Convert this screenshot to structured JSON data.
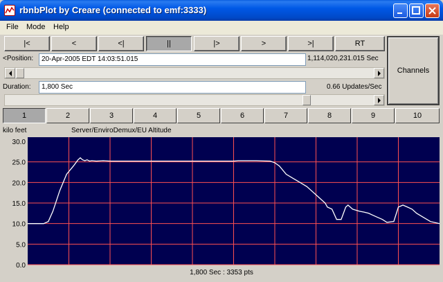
{
  "window": {
    "title": "rbnbPlot by Creare (connected to emf:3333)"
  },
  "menu": [
    "File",
    "Mode",
    "Help"
  ],
  "nav_buttons": [
    "|<",
    "<",
    "<|",
    "||",
    "|>",
    ">",
    ">|",
    "RT"
  ],
  "position": {
    "label": "<Position:",
    "value": "20-Apr-2005 EDT 14:03:51.015",
    "seconds": "1,114,020,231.015 Sec"
  },
  "duration": {
    "label": "Duration:",
    "value": "1,800 Sec",
    "rate": "0.66 Updates/Sec"
  },
  "channels_label": "Channels",
  "tabs": [
    "1",
    "2",
    "3",
    "4",
    "5",
    "6",
    "7",
    "8",
    "9",
    "10"
  ],
  "plot": {
    "units": "kilo feet",
    "channel": "Server/EnviroDemux/EU Altitude",
    "status": "1,800 Sec : 3353 pts"
  },
  "colors": {
    "plot_bg": "#000050",
    "grid": "#ff5050",
    "trace": "#ffffff"
  },
  "chart_data": {
    "type": "line",
    "ylabel": "kilo feet",
    "ylim": [
      0,
      30
    ],
    "yticks": [
      "30.0",
      "25.0",
      "20.0",
      "15.0",
      "10.0",
      "5.0",
      "0.0"
    ],
    "xlim": [
      0,
      1800
    ],
    "series": [
      {
        "name": "Server/EnviroDemux/EU Altitude",
        "x": [
          0,
          50,
          70,
          90,
          110,
          140,
          170,
          200,
          220,
          230,
          240,
          250,
          260,
          270,
          280,
          300,
          330,
          360,
          400,
          500,
          600,
          700,
          800,
          900,
          920,
          1000,
          1060,
          1080,
          1100,
          1130,
          1160,
          1190,
          1220,
          1240,
          1260,
          1280,
          1300,
          1310,
          1330,
          1350,
          1370,
          1390,
          1400,
          1420,
          1450,
          1470,
          1490,
          1510,
          1530,
          1550,
          1570,
          1600,
          1620,
          1640,
          1660,
          1680,
          1700,
          1730,
          1760,
          1800
        ],
        "y": [
          10,
          10,
          10,
          10.5,
          13,
          18,
          22,
          24,
          25.5,
          26,
          25.5,
          25.3,
          25.5,
          25.2,
          25.3,
          25.2,
          25.3,
          25.2,
          25.2,
          25.2,
          25.2,
          25.2,
          25.2,
          25.2,
          25.3,
          25.3,
          25.2,
          24.8,
          24,
          22,
          21,
          20,
          19,
          18,
          17,
          16,
          15,
          14,
          13.5,
          11,
          11,
          14,
          14.5,
          13.5,
          13,
          12.8,
          12.5,
          12,
          11.5,
          11,
          10.3,
          10.5,
          14,
          14.5,
          14,
          13.5,
          12.5,
          11.5,
          10.5,
          10
        ]
      }
    ]
  }
}
